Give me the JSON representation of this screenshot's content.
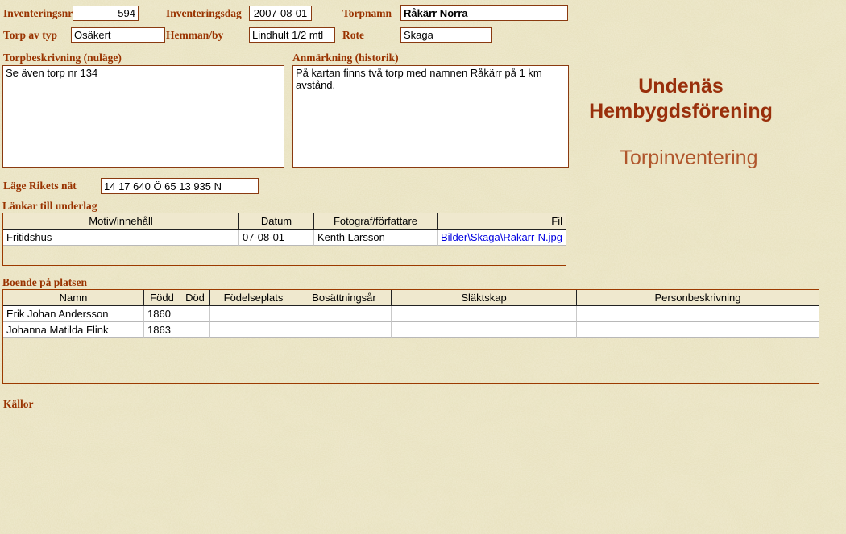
{
  "page": {
    "background_color": "#e6dfba",
    "accent_color": "#993300",
    "link_color": "#0000e0"
  },
  "branding": {
    "title_line1": "Undenäs",
    "title_line2": "Hembygdsförening",
    "subtitle": "Torpinventering"
  },
  "fields": {
    "inventeringsnr": {
      "label": "Inventeringsnr",
      "value": "594"
    },
    "inventeringsdag": {
      "label": "Inventeringsdag",
      "value": "2007-08-01"
    },
    "torpnamn": {
      "label": "Torpnamn",
      "value": "Råkärr Norra"
    },
    "torp_av_typ": {
      "label": "Torp av typ",
      "value": "Osäkert"
    },
    "hemman_by": {
      "label": "Hemman/by",
      "value": "Lindhult 1/2 mtl"
    },
    "rote": {
      "label": "Rote",
      "value": "Skaga"
    },
    "torpbeskrivning": {
      "label": "Torpbeskrivning (nuläge)",
      "value": "Se även torp nr 134"
    },
    "anmarkning": {
      "label": "Anmärkning (historik)",
      "value": "På kartan finns två torp med namnen Råkärr på 1 km avstånd."
    },
    "lage_rikets_nat": {
      "label": "Läge Rikets nät",
      "value": "14 17 640 Ö 65 13 935 N"
    }
  },
  "links_table": {
    "section_label": "Länkar till underlag",
    "headers": [
      "Motiv/innehåll",
      "Datum",
      "Fotograf/författare",
      "Fil"
    ],
    "rows": [
      {
        "motiv": "Fritidshus",
        "datum": "07-08-01",
        "fotograf": "Kenth Larsson",
        "fil": "Bilder\\Skaga\\Rakarr-N.jpg"
      }
    ]
  },
  "residents_table": {
    "section_label": "Boende på platsen",
    "headers": [
      "Namn",
      "Född",
      "Död",
      "Födelseplats",
      "Bosättningsår",
      "Släktskap",
      "Personbeskrivning"
    ],
    "rows": [
      {
        "namn": "Erik Johan Andersson",
        "fodd": "1860",
        "dod": "",
        "fodelseplats": "",
        "bosattningsar": "",
        "slaktskap": "",
        "personbeskrivning": ""
      },
      {
        "namn": "Johanna Matilda Flink",
        "fodd": "1863",
        "dod": "",
        "fodelseplats": "",
        "bosattningsar": "",
        "slaktskap": "",
        "personbeskrivning": ""
      }
    ]
  },
  "sources": {
    "label": "Källor"
  }
}
